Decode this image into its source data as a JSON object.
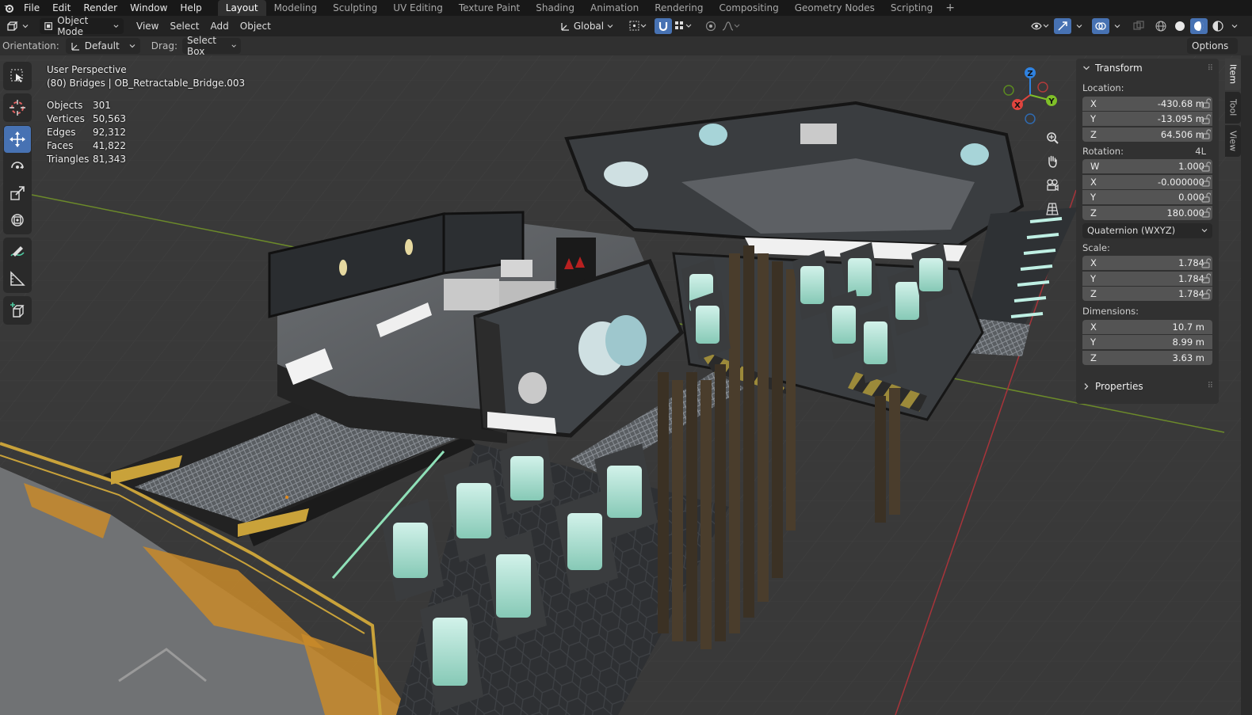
{
  "menu": [
    "File",
    "Edit",
    "Render",
    "Window",
    "Help"
  ],
  "workspaces": [
    "Layout",
    "Modeling",
    "Sculpting",
    "UV Editing",
    "Texture Paint",
    "Shading",
    "Animation",
    "Rendering",
    "Compositing",
    "Geometry Nodes",
    "Scripting"
  ],
  "active_workspace": "Layout",
  "header": {
    "mode": "Object Mode",
    "view": "View",
    "select": "Select",
    "add": "Add",
    "object": "Object",
    "transform_orientation": "Global",
    "options": "Options"
  },
  "tool_header": {
    "orientation_label": "Orientation:",
    "orientation_value": "Default",
    "drag_label": "Drag:",
    "drag_value": "Select Box"
  },
  "viewport": {
    "perspective": "User Perspective",
    "active_info": "(80) Bridges | OB_Retractable_Bridge.003",
    "stats": [
      {
        "label": "Objects",
        "value": "301"
      },
      {
        "label": "Vertices",
        "value": "50,563"
      },
      {
        "label": "Edges",
        "value": "92,312"
      },
      {
        "label": "Faces",
        "value": "41,822"
      },
      {
        "label": "Triangles",
        "value": "81,343"
      }
    ],
    "gizmo_axes": {
      "x": "X",
      "y": "Y",
      "z": "Z"
    },
    "axis_colors": {
      "x": "#e0443e",
      "y": "#7fbf28",
      "z": "#2f82e0"
    }
  },
  "npanel": {
    "transform_title": "Transform",
    "location_label": "Location:",
    "location": [
      {
        "axis": "X",
        "value": "-430.68 m"
      },
      {
        "axis": "Y",
        "value": "-13.095 m"
      },
      {
        "axis": "Z",
        "value": "64.506 m"
      }
    ],
    "rotation_label": "Rotation:",
    "rotation_lock_tag": "4L",
    "rotation": [
      {
        "axis": "W",
        "value": "1.000"
      },
      {
        "axis": "X",
        "value": "-0.000000"
      },
      {
        "axis": "Y",
        "value": "0.000"
      },
      {
        "axis": "Z",
        "value": "180.000"
      }
    ],
    "rotation_mode": "Quaternion (WXYZ)",
    "scale_label": "Scale:",
    "scale": [
      {
        "axis": "X",
        "value": "1.784"
      },
      {
        "axis": "Y",
        "value": "1.784"
      },
      {
        "axis": "Z",
        "value": "1.784"
      }
    ],
    "dimensions_label": "Dimensions:",
    "dimensions": [
      {
        "axis": "X",
        "value": "10.7 m"
      },
      {
        "axis": "Y",
        "value": "8.99 m"
      },
      {
        "axis": "Z",
        "value": "3.63 m"
      }
    ],
    "properties_title": "Properties",
    "tabs": [
      "Item",
      "Tool",
      "View"
    ]
  },
  "colors": {
    "accent": "#4772b3"
  }
}
